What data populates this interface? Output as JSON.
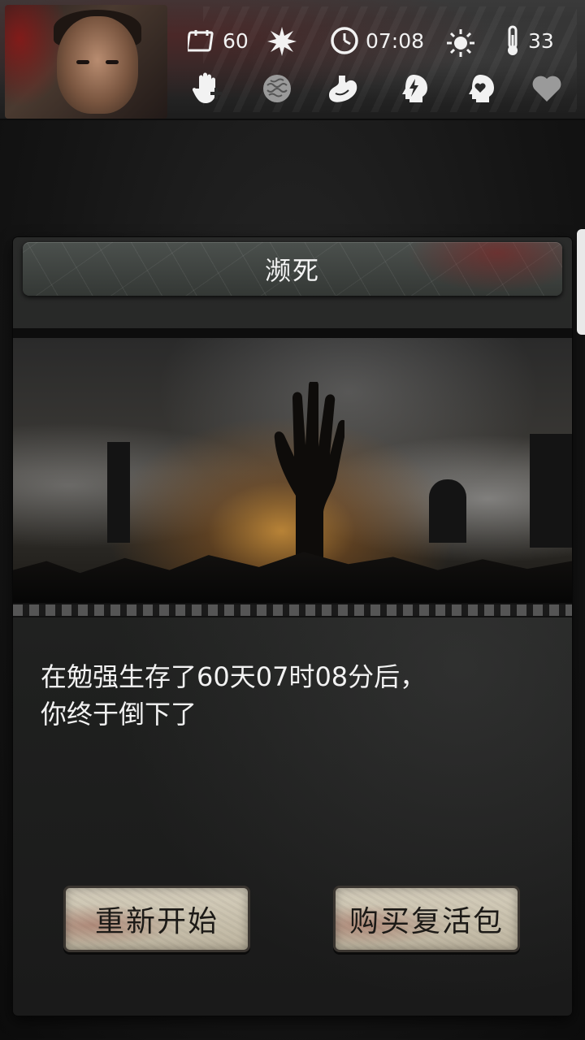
{
  "hud": {
    "days": "60",
    "time": "07:08",
    "temperature": "33",
    "icons": {
      "calendar": "calendar-icon",
      "weather": "sun-burst-icon",
      "clock": "clock-icon",
      "daylight": "sun-icon",
      "thermometer": "thermometer-icon",
      "health": "medical-hand-icon",
      "brain": "brain-icon",
      "stomach": "stomach-icon",
      "energy": "energy-head-icon",
      "mood": "mood-head-icon",
      "heart": "heart-icon"
    }
  },
  "dialog": {
    "title": "濒死",
    "message_line1": "在勉强生存了60天07时08分后，",
    "message_line2": "你终于倒下了"
  },
  "buttons": {
    "restart": "重新开始",
    "buy_revive": "购买复活包"
  },
  "colors": {
    "blood": "#8a1414",
    "button_paper": "#cfc7b3",
    "text": "#f2f2f2"
  }
}
